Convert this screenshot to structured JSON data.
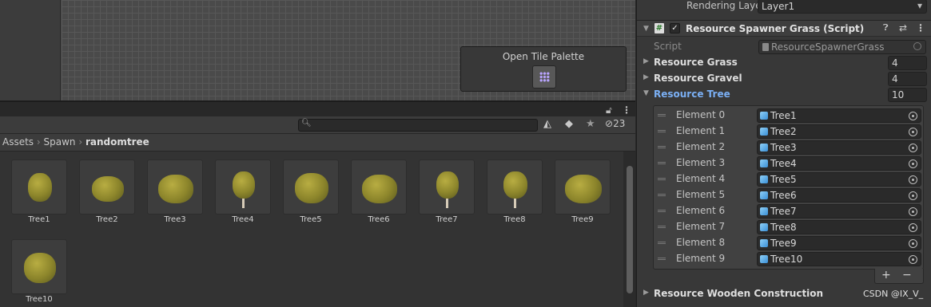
{
  "scene": {
    "tile_palette_label": "Open Tile Palette"
  },
  "project": {
    "hidden_count": "23",
    "breadcrumb": [
      "Assets",
      "Spawn",
      "randomtree"
    ],
    "assets": [
      "Tree1",
      "Tree2",
      "Tree3",
      "Tree4",
      "Tree5",
      "Tree6",
      "Tree7",
      "Tree8",
      "Tree9",
      "Tree10"
    ]
  },
  "inspector": {
    "rendering_layer_label": "Rendering Layer Mas",
    "rendering_layer_value": "Layer1",
    "component_title": "Resource Spawner Grass (Script)",
    "script_label": "Script",
    "script_value": "ResourceSpawnerGrass",
    "fields": [
      {
        "label": "Resource Grass",
        "value": "4"
      },
      {
        "label": "Resource Gravel",
        "value": "4"
      },
      {
        "label": "Resource Tree",
        "value": "10"
      }
    ],
    "elements": [
      {
        "label": "Element 0",
        "value": "Tree1"
      },
      {
        "label": "Element 1",
        "value": "Tree2"
      },
      {
        "label": "Element 2",
        "value": "Tree3"
      },
      {
        "label": "Element 3",
        "value": "Tree4"
      },
      {
        "label": "Element 4",
        "value": "Tree5"
      },
      {
        "label": "Element 5",
        "value": "Tree6"
      },
      {
        "label": "Element 6",
        "value": "Tree7"
      },
      {
        "label": "Element 7",
        "value": "Tree8"
      },
      {
        "label": "Element 8",
        "value": "Tree9"
      },
      {
        "label": "Element 9",
        "value": "Tree10"
      }
    ],
    "add_label": "+",
    "remove_label": "−",
    "next_field_label": "Resource Wooden Construction"
  },
  "watermark": "CSDN @IX_V_",
  "colors": {
    "accent_blue": "#7bb0f5",
    "tile_icon": "#b9a4ff",
    "prefab_cube": "#5aaee8"
  },
  "icons": [
    "search-icon",
    "lock-icon",
    "kebab-menu-icon",
    "filter-icon",
    "tag-icon",
    "star-icon",
    "eye-hidden-icon",
    "grid-icon",
    "script-icon",
    "checkbox-icon",
    "help-icon",
    "preset-icon",
    "prefab-cube-icon",
    "object-picker-icon",
    "drag-handle-icon",
    "foldout-triangle-icon"
  ]
}
